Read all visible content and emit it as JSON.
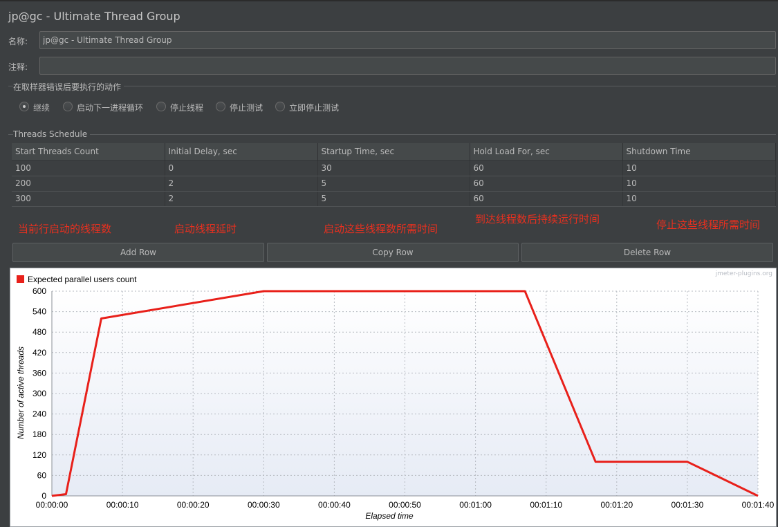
{
  "window": {
    "title": "jp@gc - Ultimate Thread Group"
  },
  "form": {
    "name_label": "名称:",
    "name_value": "jp@gc - Ultimate Thread Group",
    "comment_label": "注释:",
    "comment_value": ""
  },
  "error_action": {
    "title": "在取样器错误后要执行的动作",
    "options": [
      {
        "label": "继续",
        "checked": true
      },
      {
        "label": "启动下一进程循环",
        "checked": false
      },
      {
        "label": "停止线程",
        "checked": false
      },
      {
        "label": "停止测试",
        "checked": false
      },
      {
        "label": "立即停止测试",
        "checked": false
      }
    ]
  },
  "schedule": {
    "title": "Threads Schedule",
    "columns": [
      "Start Threads Count",
      "Initial Delay, sec",
      "Startup Time, sec",
      "Hold Load For, sec",
      "Shutdown Time"
    ],
    "rows": [
      [
        "100",
        "0",
        "30",
        "60",
        "10"
      ],
      [
        "200",
        "2",
        "5",
        "60",
        "10"
      ],
      [
        "300",
        "2",
        "5",
        "60",
        "10"
      ]
    ]
  },
  "annotations": [
    "当前行启动的线程数",
    "启动线程延时",
    "启动这些线程数所需时间",
    "到达线程数后持续运行时间",
    "停止这些线程所需时间"
  ],
  "buttons": {
    "add_row": "Add Row",
    "copy_row": "Copy Row",
    "delete_row": "Delete Row"
  },
  "colors": {
    "accent_annotation": "#e8301f",
    "series_line": "#e8201a",
    "panel_bg": "#3c3f41"
  },
  "chart_data": {
    "type": "line",
    "watermark": "jmeter-plugins.org",
    "xlabel": "Elapsed time",
    "ylabel": "Number of active threads",
    "xlim": [
      0,
      100
    ],
    "ylim": [
      0,
      600
    ],
    "yticks": [
      0,
      60,
      120,
      180,
      240,
      300,
      360,
      420,
      480,
      540,
      600
    ],
    "xticks": [
      {
        "value": 0,
        "label": "00:00:00"
      },
      {
        "value": 10,
        "label": "00:00:10"
      },
      {
        "value": 20,
        "label": "00:00:20"
      },
      {
        "value": 30,
        "label": "00:00:30"
      },
      {
        "value": 40,
        "label": "00:00:40"
      },
      {
        "value": 50,
        "label": "00:00:50"
      },
      {
        "value": 60,
        "label": "00:01:00"
      },
      {
        "value": 70,
        "label": "00:01:10"
      },
      {
        "value": 80,
        "label": "00:01:20"
      },
      {
        "value": 90,
        "label": "00:01:30"
      },
      {
        "value": 100,
        "label": "00:01:40"
      }
    ],
    "grid": true,
    "legend_position": "top-left",
    "series": [
      {
        "name": "Expected parallel users count",
        "color": "#e8201a",
        "x": [
          0,
          2,
          7,
          30,
          67,
          77,
          90,
          100
        ],
        "y": [
          0,
          5,
          520,
          600,
          600,
          100,
          100,
          0
        ]
      }
    ]
  }
}
